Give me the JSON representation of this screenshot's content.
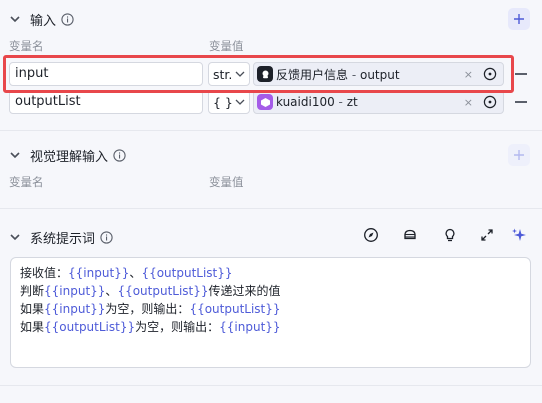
{
  "input_section": {
    "title": "输入",
    "col_name": "变量名",
    "col_value": "变量值",
    "rows": [
      {
        "name": "input",
        "type": "str.",
        "source_label": "反馈用户信息",
        "source_sep": " - ",
        "source_field": "output"
      },
      {
        "name": "outputList",
        "type": "{ }",
        "source_label": "kuaidi100",
        "source_sep": " - ",
        "source_field": "zt"
      }
    ],
    "clear_glyph": "×"
  },
  "visual_section": {
    "title": "视觉理解输入",
    "col_name": "变量名",
    "col_value": "变量值"
  },
  "system_prompt": {
    "title": "系统提示词",
    "lines": [
      [
        {
          "t": "接收值：",
          "v": false
        },
        {
          "t": "{{input}}",
          "v": true
        },
        {
          "t": "、",
          "v": false
        },
        {
          "t": "{{outputList}}",
          "v": true
        }
      ],
      [
        {
          "t": "判断",
          "v": false
        },
        {
          "t": "{{input}}",
          "v": true
        },
        {
          "t": "、",
          "v": false
        },
        {
          "t": "{{outputList}}",
          "v": true
        },
        {
          "t": "传递过来的值",
          "v": false
        }
      ],
      [
        {
          "t": "如果",
          "v": false
        },
        {
          "t": "{{input}}",
          "v": true
        },
        {
          "t": "为空，则输出：",
          "v": false
        },
        {
          "t": "{{outputList}}",
          "v": true
        }
      ],
      [
        {
          "t": "如果",
          "v": false
        },
        {
          "t": "{{outputList}}",
          "v": true
        },
        {
          "t": "为空，则输出：",
          "v": false
        },
        {
          "t": "{{input}}",
          "v": true
        }
      ]
    ]
  },
  "colors": {
    "accent": "#4e5bd8",
    "highlight": "#e8474b",
    "node1_icon_bg": "#1d2129",
    "node2_icon_bg": "#a55ce8"
  },
  "icons": [
    "plus-icon",
    "info-icon",
    "chevron-down-icon",
    "compass-icon",
    "robot-icon",
    "lightbulb-icon",
    "expand-icon",
    "sparkle-icon",
    "target-icon"
  ]
}
